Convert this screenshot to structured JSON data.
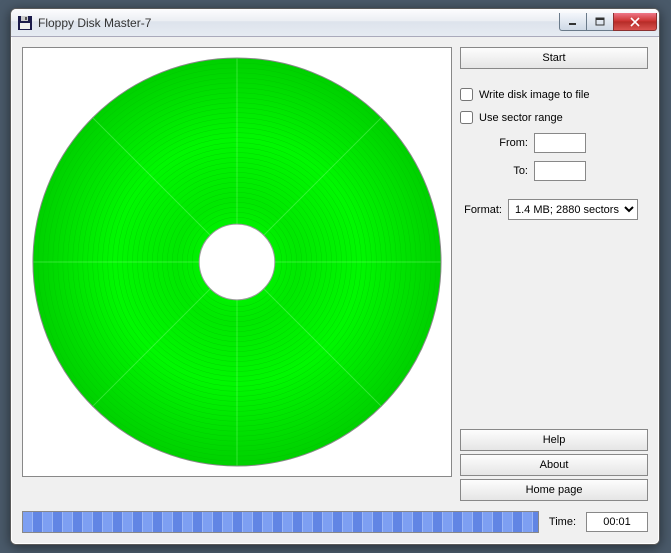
{
  "window": {
    "title": "Floppy Disk Master-7"
  },
  "buttons": {
    "start": "Start",
    "help": "Help",
    "about": "About",
    "homepage": "Home page"
  },
  "options": {
    "write_image_label": "Write disk image to file",
    "write_image_checked": false,
    "use_sector_range_label": "Use sector range",
    "use_sector_range_checked": false,
    "from_label": "From:",
    "from_value": "",
    "to_label": "To:",
    "to_value": "",
    "format_label": "Format:",
    "format_value": "1.4 MB; 2880 sectors"
  },
  "status": {
    "time_label": "Time:",
    "time_value": "00:01",
    "progress_percent": 100
  },
  "colors": {
    "disk_fill": "#00e000",
    "disk_stroke": "#008000",
    "progress": "#6b8fe8"
  }
}
